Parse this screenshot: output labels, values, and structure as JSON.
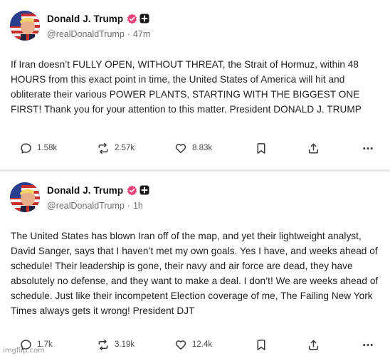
{
  "posts": [
    {
      "author_name": "Donald J. Trump",
      "handle": "@realDonaldTrump",
      "time": "47m",
      "text": "If Iran doesn’t FULLY OPEN, WITHOUT THREAT, the Strait of Hormuz, within 48 HOURS from this exact point in time, the United States of America will hit and obliterate their various POWER PLANTS, STARTING WITH THE BIGGEST ONE FIRST! Thank you for your attention to this matter. President DONALD J. TRUMP",
      "replies": "1.58k",
      "retruths": "2.57k",
      "likes": "8.83k"
    },
    {
      "author_name": "Donald J. Trump",
      "handle": "@realDonaldTrump",
      "time": "1h",
      "text": "The United States has blown Iran off of the map, and yet their lightweight analyst, David Sanger, says that I haven’t met my own goals. Yes I have, and weeks ahead of schedule! Their leadership is gone, their navy and air force are dead, they have absolutely no defense, and they want to make a deal. I don’t! We are weeks ahead of schedule. Just like their incompetent Election coverage of me, The Failing New York Times always gets it wrong! President DJT",
      "replies": "1.7k",
      "retruths": "3.19k",
      "likes": "12.4k"
    }
  ],
  "separator": "·",
  "watermark": "imgflip.com",
  "icons": {
    "reply": "speech-bubble-icon",
    "retruth": "repost-arrows-icon",
    "like": "heart-icon",
    "bookmark": "bookmark-icon",
    "share": "share-upload-icon",
    "more": "more-dots-icon",
    "verified": "verified-badge-icon",
    "plus": "plus-badge-icon"
  },
  "colors": {
    "verified": "#e8447a",
    "badge": "#1a1a1a",
    "text": "#1f1f1f",
    "muted": "#6b6b6b",
    "divider": "#e6e6e6"
  }
}
